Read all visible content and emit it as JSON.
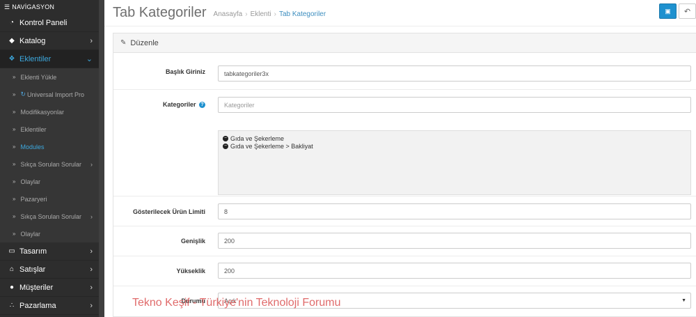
{
  "sidebar": {
    "header": "NAVİGASYON",
    "items": [
      {
        "label": "Kontrol Paneli",
        "icon": "dashboard-icon",
        "glyph": "◔"
      },
      {
        "label": "Katalog",
        "icon": "tag-icon",
        "glyph": "◆",
        "chevron": "›"
      },
      {
        "label": "Eklentiler",
        "icon": "puzzle-icon",
        "glyph": "❖",
        "chevron": "⌄",
        "active": true
      }
    ],
    "subitems": [
      {
        "label": "Eklenti Yükle"
      },
      {
        "label": "Universal Import Pro",
        "has_sync": true
      },
      {
        "label": "Modifikasyonlar"
      },
      {
        "label": "Eklentiler"
      },
      {
        "label": "Modules",
        "active": true
      },
      {
        "label": "Sıkça Sorulan Sorular",
        "chevron": "›"
      },
      {
        "label": "Olaylar"
      },
      {
        "label": "Pazaryeri"
      },
      {
        "label": "Sıkça Sorulan Sorular",
        "chevron": "›"
      },
      {
        "label": "Olaylar"
      }
    ],
    "bottom_items": [
      {
        "label": "Tasarım",
        "icon": "monitor-icon",
        "glyph": "▭",
        "chevron": "›"
      },
      {
        "label": "Satışlar",
        "icon": "cart-icon",
        "glyph": "⌂",
        "chevron": "›"
      },
      {
        "label": "Müşteriler",
        "icon": "user-icon",
        "glyph": "●",
        "chevron": "›"
      },
      {
        "label": "Pazarlama",
        "icon": "share-icon",
        "glyph": "∴",
        "chevron": "›"
      }
    ]
  },
  "header": {
    "title": "Tab Kategoriler",
    "breadcrumb": [
      "Anasayfa",
      "Eklenti",
      "Tab Kategoriler"
    ],
    "save_icon": "save-icon",
    "back_icon": "back-icon"
  },
  "panel": {
    "heading": "Düzenle",
    "fields": {
      "title_label": "Başlık Giriniz",
      "title_value": "tabkategoriler3x",
      "categories_label": "Kategoriler",
      "categories_placeholder": "Kategoriler",
      "selected_categories": [
        "Gıda ve Şekerleme",
        "Gıda ve Şekerleme  >  Bakliyat"
      ],
      "limit_label": "Gösterilecek Ürün Limiti",
      "limit_value": "8",
      "width_label": "Genişlik",
      "width_value": "200",
      "height_label": "Yükseklik",
      "height_value": "200",
      "status_label": "Durumu",
      "status_value": "Açık"
    }
  },
  "watermark": "Tekno Keşif - Türkiye'nin Teknoloji Forumu",
  "colors": {
    "accent": "#1e91cf",
    "sidebar": "#2d2d2d",
    "active_link": "#3da9df"
  }
}
